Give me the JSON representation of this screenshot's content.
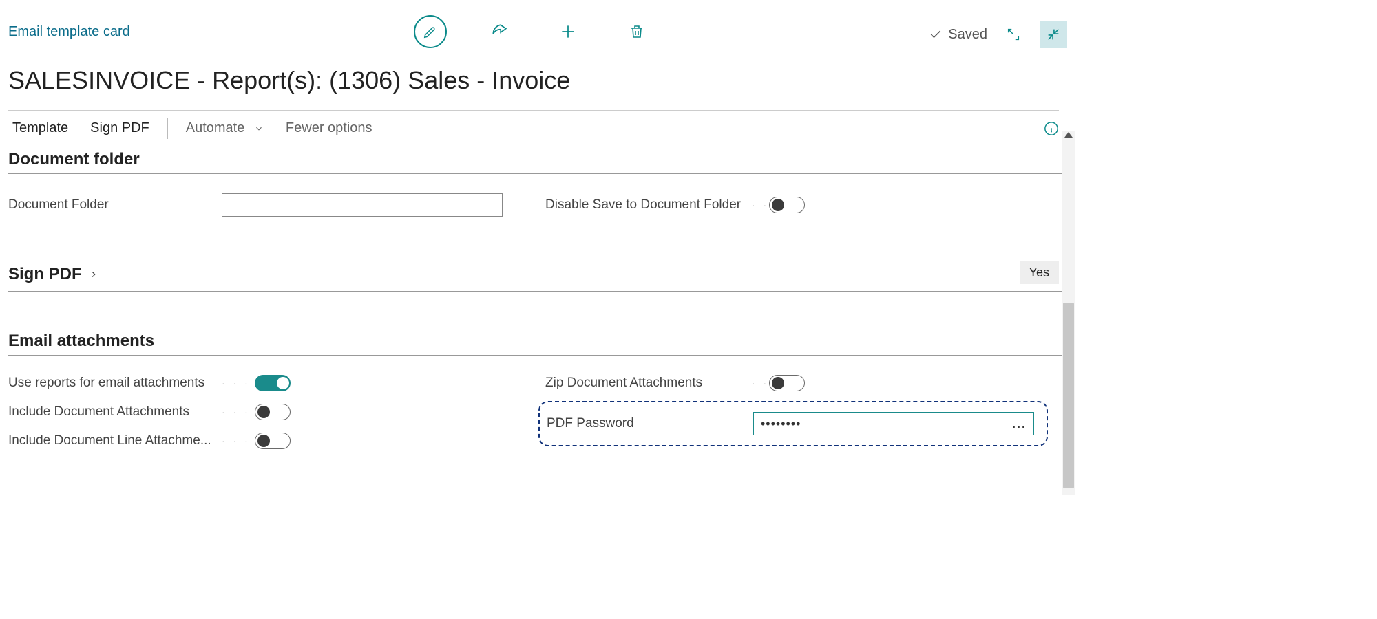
{
  "header": {
    "breadcrumb": "Email template card",
    "saved_label": "Saved",
    "title": "SALESINVOICE - Report(s): (1306) Sales - Invoice"
  },
  "commandbar": {
    "template": "Template",
    "sign_pdf": "Sign PDF",
    "automate": "Automate",
    "fewer_options": "Fewer options"
  },
  "sections": {
    "document_folder": {
      "title": "Document folder",
      "folder_label": "Document Folder",
      "folder_value": "",
      "disable_save_label": "Disable Save to Document Folder",
      "disable_save_on": false
    },
    "sign_pdf": {
      "title": "Sign PDF",
      "badge": "Yes"
    },
    "email_attachments": {
      "title": "Email attachments",
      "use_reports_label": "Use reports for email attachments",
      "use_reports_on": true,
      "include_doc_label": "Include Document Attachments",
      "include_doc_on": false,
      "include_line_label": "Include Document Line Attachme...",
      "include_line_on": false,
      "zip_label": "Zip Document Attachments",
      "zip_on": false,
      "pdf_password_label": "PDF Password",
      "pdf_password_mask": "••••••••",
      "pdf_password_more": "..."
    }
  }
}
